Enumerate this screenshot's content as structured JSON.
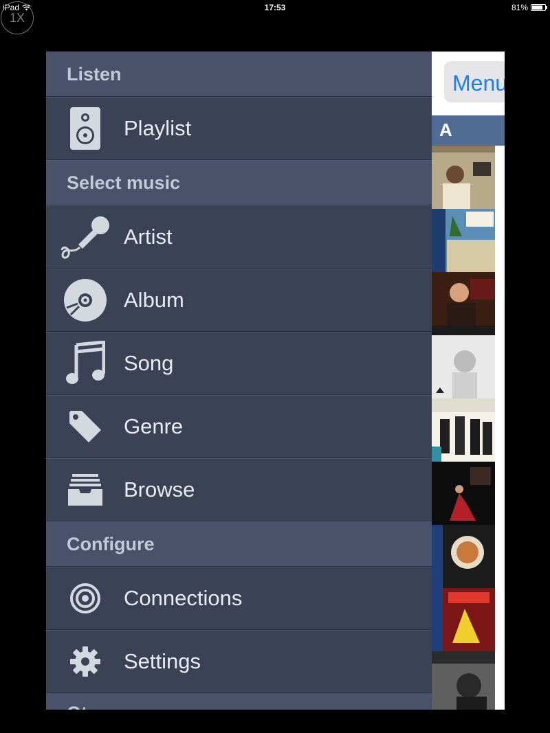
{
  "status_bar": {
    "device": "iPad",
    "time": "17:53",
    "battery": "81%",
    "battery_level": 0.81
  },
  "zoom_badge": "1X",
  "main_view": {
    "menu_button_label": "Menu",
    "section_letter": "A"
  },
  "drawer": {
    "sections": {
      "listen": "Listen",
      "select_music": "Select music",
      "configure": "Configure",
      "other_partial": "Ot"
    },
    "items": {
      "playlist": "Playlist",
      "artist": "Artist",
      "album": "Album",
      "song": "Song",
      "genre": "Genre",
      "browse": "Browse",
      "connections": "Connections",
      "settings": "Settings"
    }
  },
  "icons": {
    "playlist": "speaker-icon",
    "artist": "microphone-icon",
    "album": "disc-icon",
    "song": "music-note-icon",
    "genre": "tag-icon",
    "browse": "inbox-tray-icon",
    "connections": "target-icon",
    "settings": "gear-icon"
  },
  "colors": {
    "drawer_bg": "#3b4256",
    "section_bg": "#49526a",
    "accent": "#1a7ff0",
    "letter_header": "#516c94"
  }
}
